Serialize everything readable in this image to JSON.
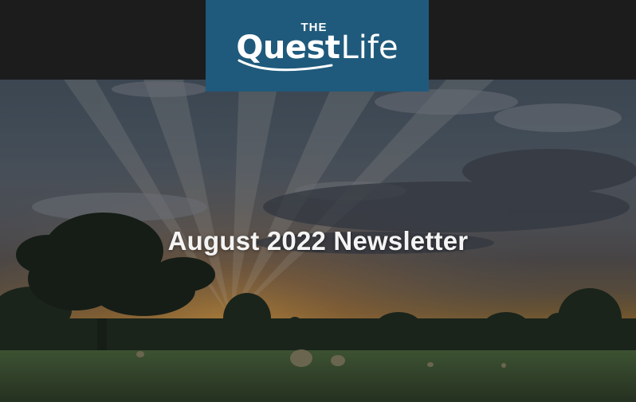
{
  "brand": {
    "prefix": "THE",
    "name_bold": "Quest",
    "name_light": "Life",
    "background_color": "#1f5a7c"
  },
  "hero": {
    "headline": "August 2022 Newsletter"
  },
  "colors": {
    "top_bar": "#1c1c1d",
    "headline_text": "#f4f4f4"
  }
}
